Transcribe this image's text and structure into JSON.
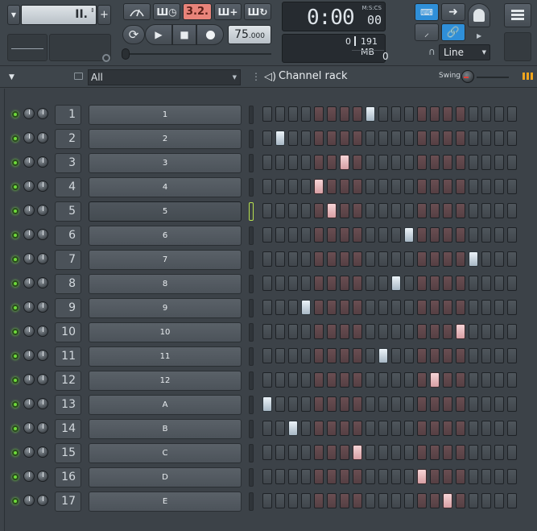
{
  "toolbar": {
    "pattern_value": "II.",
    "pattern_add_label": "+",
    "song_position": "3.2.",
    "tempo_value": "75",
    "tempo_fraction": ".000",
    "time_display": "0:00",
    "time_fraction": "00",
    "time_label": "M:S:CS",
    "cpu_value": "0",
    "memory_value": "191 MB",
    "polyphony_value": "0",
    "snap_mode": "Line"
  },
  "rack_header": {
    "filter_value": "All",
    "title": "Channel rack",
    "swing_label": "Swing"
  },
  "colors": {
    "led_green": "#6edb3a",
    "selected_outline": "#b7e04f",
    "step_on_white": "#dfe8ef",
    "step_on_pink": "#e8b7bb",
    "accent_blue": "#3aa0e8"
  },
  "channels": [
    {
      "number": "1",
      "name": "1",
      "active_step": 8
    },
    {
      "number": "2",
      "name": "2",
      "active_step": 1
    },
    {
      "number": "3",
      "name": "3",
      "active_step": 6
    },
    {
      "number": "4",
      "name": "4",
      "active_step": 4
    },
    {
      "number": "5",
      "name": "5",
      "active_step": 5
    },
    {
      "number": "6",
      "name": "6",
      "active_step": 11
    },
    {
      "number": "7",
      "name": "7",
      "active_step": 16
    },
    {
      "number": "8",
      "name": "8",
      "active_step": 10
    },
    {
      "number": "9",
      "name": "9",
      "active_step": 3
    },
    {
      "number": "10",
      "name": "10",
      "active_step": 15
    },
    {
      "number": "11",
      "name": "11",
      "active_step": 9
    },
    {
      "number": "12",
      "name": "12",
      "active_step": 13
    },
    {
      "number": "13",
      "name": "A",
      "active_step": 0
    },
    {
      "number": "14",
      "name": "B",
      "active_step": 2
    },
    {
      "number": "15",
      "name": "C",
      "active_step": 7
    },
    {
      "number": "16",
      "name": "D",
      "active_step": 12
    },
    {
      "number": "17",
      "name": "E",
      "active_step": 14
    }
  ],
  "selected_channel": 4,
  "steps_per_channel": 20
}
